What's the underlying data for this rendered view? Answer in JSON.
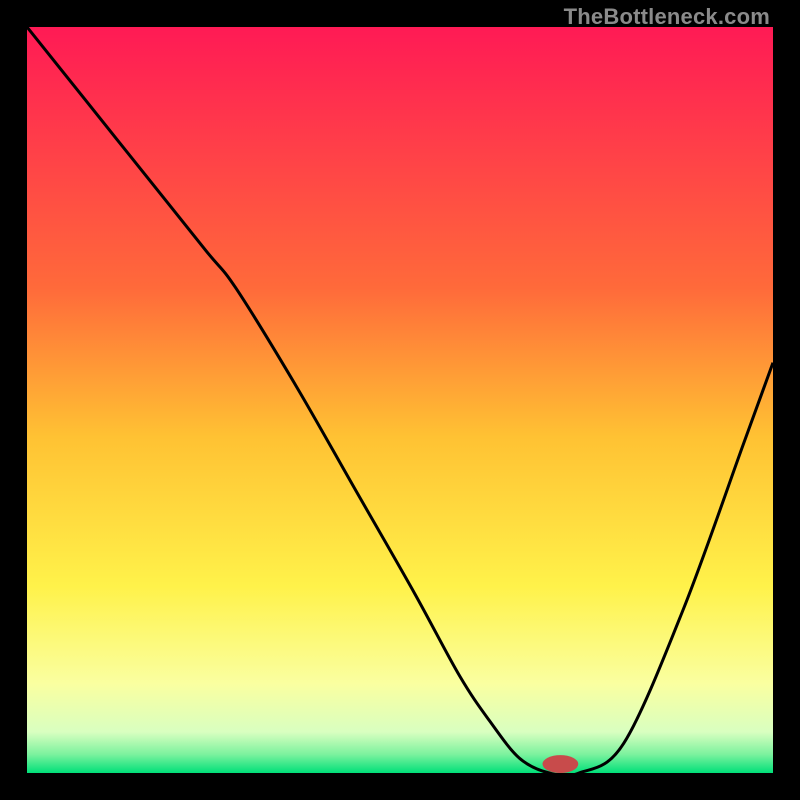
{
  "watermark": "TheBottleneck.com",
  "chart_data": {
    "type": "line",
    "title": "",
    "xlabel": "",
    "ylabel": "",
    "xlim": [
      0,
      100
    ],
    "ylim": [
      0,
      100
    ],
    "background_gradient": {
      "stops": [
        {
          "pos": 0.0,
          "color": "#ff1a55"
        },
        {
          "pos": 0.35,
          "color": "#ff6a3a"
        },
        {
          "pos": 0.55,
          "color": "#ffc233"
        },
        {
          "pos": 0.75,
          "color": "#fff24a"
        },
        {
          "pos": 0.88,
          "color": "#faffa0"
        },
        {
          "pos": 0.945,
          "color": "#d9ffc0"
        },
        {
          "pos": 0.975,
          "color": "#7cf29e"
        },
        {
          "pos": 1.0,
          "color": "#00e079"
        }
      ]
    },
    "series": [
      {
        "name": "bottleneck-curve",
        "color": "#000000",
        "x": [
          0,
          8,
          16,
          24,
          28,
          36,
          44,
          52,
          58,
          62,
          66,
          70,
          74,
          80,
          88,
          96,
          100
        ],
        "y": [
          100,
          90,
          80,
          70,
          65,
          52,
          38,
          24,
          13,
          7,
          2,
          0,
          0,
          4,
          22,
          44,
          55
        ]
      }
    ],
    "marker": {
      "name": "optimal-point",
      "x": 71.5,
      "y": 1.2,
      "rx": 2.4,
      "ry": 1.2,
      "color": "#c84b4b"
    }
  }
}
